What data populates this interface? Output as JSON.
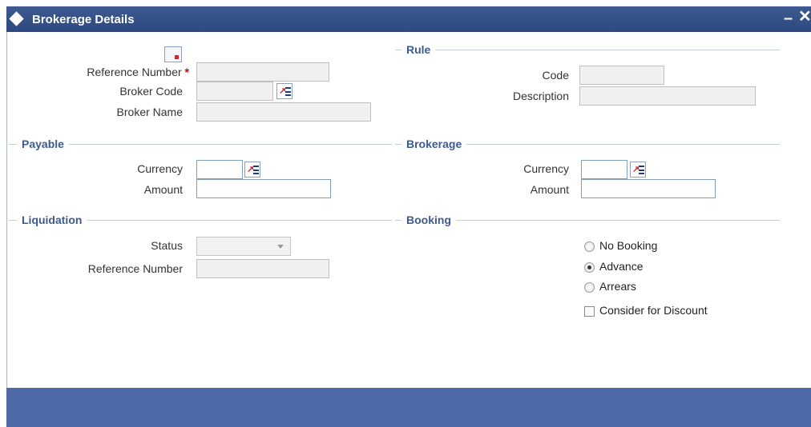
{
  "window": {
    "title": "Brokerage Details",
    "minimize_label": "–",
    "close_label": "✕"
  },
  "main": {
    "reference_number_label": "Reference Number",
    "required_mark": "*",
    "broker_code_label": "Broker Code",
    "broker_name_label": "Broker Name",
    "reference_number_value": "",
    "broker_code_value": "",
    "broker_name_value": ""
  },
  "rule": {
    "section_label": "Rule",
    "code_label": "Code",
    "description_label": "Description",
    "code_value": "",
    "description_value": ""
  },
  "payable": {
    "section_label": "Payable",
    "currency_label": "Currency",
    "amount_label": "Amount",
    "currency_value": "",
    "amount_value": ""
  },
  "brokerage": {
    "section_label": "Brokerage",
    "currency_label": "Currency",
    "amount_label": "Amount",
    "currency_value": "",
    "amount_value": ""
  },
  "liquidation": {
    "section_label": "Liquidation",
    "status_label": "Status",
    "status_value": "",
    "reference_number_label": "Reference Number",
    "reference_number_value": ""
  },
  "booking": {
    "section_label": "Booking",
    "options": [
      {
        "label": "No Booking",
        "checked": false
      },
      {
        "label": "Advance",
        "checked": true
      },
      {
        "label": "Arrears",
        "checked": false
      }
    ],
    "consider_discount_label": "Consider for Discount",
    "consider_discount_checked": false
  },
  "icons": {
    "lov": "list-of-values-icon",
    "document": "document-icon",
    "dropdown": "chevron-down-icon"
  },
  "colors": {
    "titlebar": "#2c4a80",
    "footer": "#4e6aa8",
    "section_header": "#3d5a8f"
  }
}
